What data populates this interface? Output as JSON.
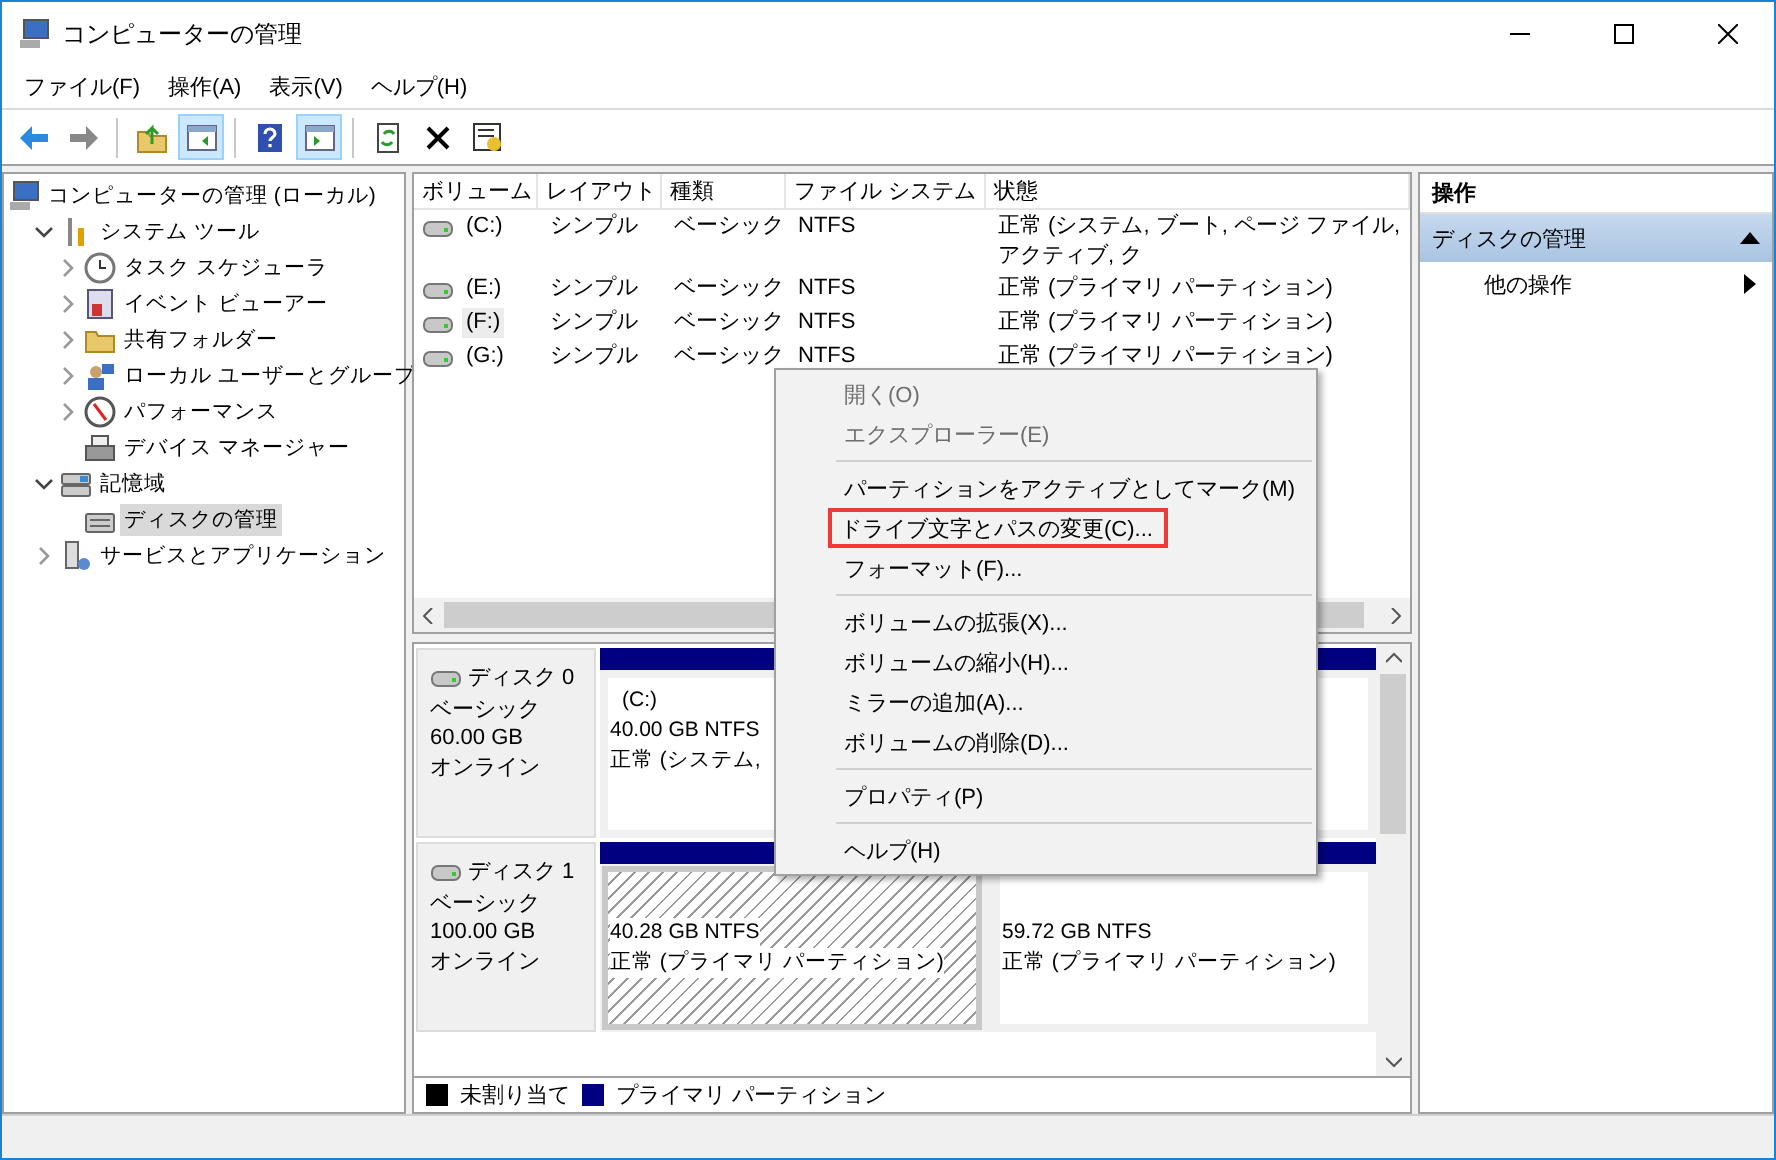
{
  "window": {
    "title": "コンピューターの管理"
  },
  "menu_bar": [
    "ファイル(F)",
    "操作(A)",
    "表示(V)",
    "ヘルプ(H)"
  ],
  "toolbar": [
    {
      "kind": "back",
      "pressed": false
    },
    {
      "kind": "forward",
      "pressed": false
    },
    {
      "kind": "sep"
    },
    {
      "kind": "up",
      "pressed": false
    },
    {
      "kind": "tree",
      "pressed": true
    },
    {
      "kind": "sep"
    },
    {
      "kind": "help",
      "pressed": false
    },
    {
      "kind": "actions",
      "pressed": true
    },
    {
      "kind": "sep"
    },
    {
      "kind": "refresh",
      "pressed": false
    },
    {
      "kind": "delete",
      "pressed": false
    },
    {
      "kind": "properties",
      "pressed": false
    }
  ],
  "tree": [
    {
      "label": "コンピューターの管理 (ローカル)",
      "selected": false,
      "children": [
        {
          "label": "システム ツール",
          "expanded": true,
          "selected": false,
          "children": [
            {
              "label": "タスク スケジューラ",
              "expanded": false,
              "selected": false
            },
            {
              "label": "イベント ビューアー",
              "expanded": false,
              "selected": false
            },
            {
              "label": "共有フォルダー",
              "expanded": false,
              "selected": false
            },
            {
              "label": "ローカル ユーザーとグループ",
              "expanded": false,
              "selected": false
            },
            {
              "label": "パフォーマンス",
              "expanded": false,
              "selected": false
            },
            {
              "label": "デバイス マネージャー",
              "selected": false
            }
          ]
        },
        {
          "label": "記憶域",
          "expanded": true,
          "selected": false,
          "children": [
            {
              "label": "ディスクの管理",
              "selected": true
            }
          ]
        },
        {
          "label": "サービスとアプリケーション",
          "expanded": false,
          "selected": false
        }
      ]
    }
  ],
  "volume_table": {
    "columns": [
      "ボリューム",
      "レイアウト",
      "種類",
      "ファイル システム",
      "状態"
    ],
    "rows": [
      {
        "cells": [
          "(C:)",
          "シンプル",
          "ベーシック",
          "NTFS",
          "正常 (システム, ブート, ページ ファイル, アクティブ, ク"
        ],
        "selected": false
      },
      {
        "cells": [
          "(E:)",
          "シンプル",
          "ベーシック",
          "NTFS",
          "正常 (プライマリ パーティション)"
        ],
        "selected": false
      },
      {
        "cells": [
          "(F:)",
          "シンプル",
          "ベーシック",
          "NTFS",
          "正常 (プライマリ パーティション)"
        ],
        "selected": true
      },
      {
        "cells": [
          "(G:)",
          "シンプル",
          "ベーシック",
          "NTFS",
          "正常 (プライマリ パーティション)"
        ],
        "selected": false
      }
    ]
  },
  "disks": [
    {
      "name": "ディスク 0",
      "type": "ベーシック",
      "size": "60.00 GB",
      "status": "オンライン",
      "partitions": [
        {
          "label": "(C:)",
          "size": "40.00 GB NTFS",
          "status": "正常 (システム,",
          "selected": false
        }
      ]
    },
    {
      "name": "ディスク 1",
      "type": "ベーシック",
      "size": "100.00 GB",
      "status": "オンライン",
      "partitions": [
        {
          "size": "40.28 GB NTFS",
          "status": "正常 (プライマリ パーティション)",
          "selected": true
        },
        {
          "size": "59.72 GB NTFS",
          "status": "正常 (プライマリ パーティション)",
          "selected": false
        }
      ]
    }
  ],
  "legend": [
    {
      "label": "未割り当て",
      "color": "#000000"
    },
    {
      "label": "プライマリ パーティション",
      "color": "#000080"
    }
  ],
  "actions_pane": {
    "title": "操作",
    "section": {
      "label": "ディスクの管理",
      "expanded": true
    },
    "items": [
      "他の操作"
    ]
  },
  "context_menu": [
    {
      "kind": "item",
      "label": "開く(O)",
      "disabled": true,
      "highlighted": false
    },
    {
      "kind": "item",
      "label": "エクスプローラー(E)",
      "disabled": true,
      "highlighted": false
    },
    {
      "kind": "separator"
    },
    {
      "kind": "item",
      "label": "パーティションをアクティブとしてマーク(M)",
      "disabled": false,
      "highlighted": false
    },
    {
      "kind": "item",
      "label": "ドライブ文字とパスの変更(C)...",
      "disabled": false,
      "highlighted": true
    },
    {
      "kind": "item",
      "label": "フォーマット(F)...",
      "disabled": false,
      "highlighted": false
    },
    {
      "kind": "separator"
    },
    {
      "kind": "item",
      "label": "ボリュームの拡張(X)...",
      "disabled": false,
      "highlighted": false
    },
    {
      "kind": "item",
      "label": "ボリュームの縮小(H)...",
      "disabled": false,
      "highlighted": false
    },
    {
      "kind": "item",
      "label": "ミラーの追加(A)...",
      "disabled": false,
      "highlighted": false
    },
    {
      "kind": "item",
      "label": "ボリュームの削除(D)...",
      "disabled": false,
      "highlighted": false
    },
    {
      "kind": "separator"
    },
    {
      "kind": "item",
      "label": "プロパティ(P)",
      "disabled": false,
      "highlighted": false
    },
    {
      "kind": "separator"
    },
    {
      "kind": "item",
      "label": "ヘルプ(H)",
      "disabled": false,
      "highlighted": false
    }
  ]
}
